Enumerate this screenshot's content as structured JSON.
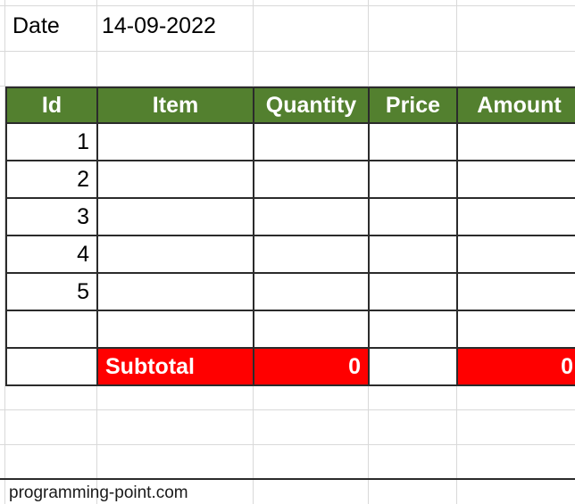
{
  "document": {
    "type": "spreadsheet",
    "colors": {
      "header_background": "#53802f",
      "header_text": "#ffffff",
      "subtotal_background": "#ff0000",
      "subtotal_text": "#ffffff",
      "gridline": "#d9d9d9",
      "table_border": "#2b2b2b"
    }
  },
  "date_row": {
    "label": "Date",
    "value": "14-09-2022"
  },
  "table": {
    "headers": [
      "Id",
      "Item",
      "Quantity",
      "Price",
      "Amount"
    ],
    "rows": [
      {
        "id": "1",
        "item": "",
        "quantity": "",
        "price": "",
        "amount": ""
      },
      {
        "id": "2",
        "item": "",
        "quantity": "",
        "price": "",
        "amount": ""
      },
      {
        "id": "3",
        "item": "",
        "quantity": "",
        "price": "",
        "amount": ""
      },
      {
        "id": "4",
        "item": "",
        "quantity": "",
        "price": "",
        "amount": ""
      },
      {
        "id": "5",
        "item": "",
        "quantity": "",
        "price": "",
        "amount": ""
      },
      {
        "id": "",
        "item": "",
        "quantity": "",
        "price": "",
        "amount": ""
      }
    ],
    "subtotal": {
      "id": "",
      "label": "Subtotal",
      "quantity": "0",
      "price": "",
      "amount": "0"
    }
  },
  "footer": {
    "text": "programming-point.com"
  }
}
